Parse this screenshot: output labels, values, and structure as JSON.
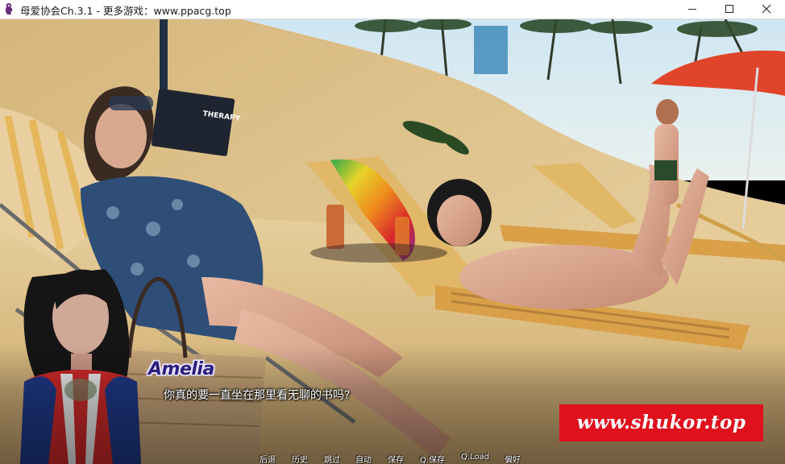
{
  "window": {
    "title": "母爱协会Ch.3.1 - 更多游戏：www.ppacg.top",
    "controls": {
      "minimize": "minimize-icon",
      "maximize": "maximize-icon",
      "close": "close-icon"
    }
  },
  "dialogue": {
    "speaker": "Amelia",
    "text": "你真的要一直坐在那里看无聊的书吗?",
    "speaker_color": "#2b1e7a"
  },
  "book": {
    "cover_text": "THERAPY"
  },
  "watermark": {
    "text": "www.shukor.top",
    "color": "#e0101c"
  },
  "quick_menu": {
    "items": [
      "后退",
      "历史",
      "跳过",
      "自动",
      "保存",
      "Q.保存",
      "Q.Load",
      "偏好"
    ]
  }
}
